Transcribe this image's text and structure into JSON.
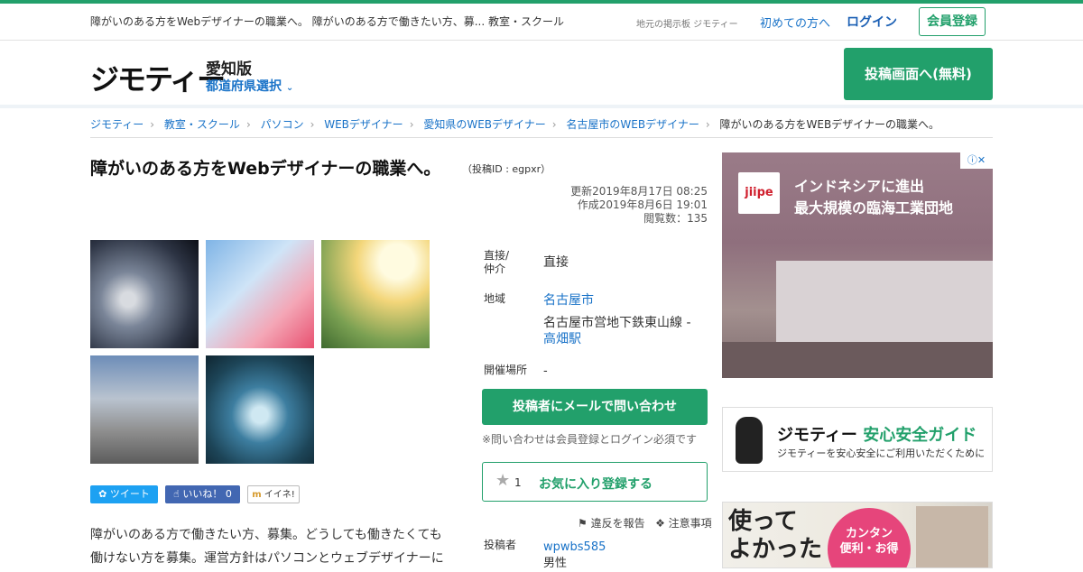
{
  "topbar": {
    "tagline": "障がいのある方をWebデザイナーの職業へ。 障がいのある方で働きたい方、募... 教室・スクール",
    "site_label": "地元の掲示板 ジモティー",
    "first_time": "初めての方へ",
    "login": "ログイン",
    "register": "会員登録"
  },
  "header": {
    "logo": "ジモティー",
    "edition": "愛知版",
    "prefecture_select": "都道府県選択",
    "post_button": "投稿画面へ(無料)"
  },
  "breadcrumbs": [
    "ジモティー",
    "教室・スクール",
    "パソコン",
    "WEBデザイナー",
    "愛知県のWEBデザイナー",
    "名古屋市のWEBデザイナー",
    "障がいのある方をWEBデザイナーの職業へ。"
  ],
  "listing": {
    "title": "障がいのある方をWebデザイナーの職業へ。",
    "post_id": "（投稿ID : egpxr）",
    "updated": "更新2019年8月17日 08:25",
    "created": "作成2019年8月6日 19:01",
    "views": "閲覧数：135",
    "description": "障がいのある方で働きたい方、募集。どうしても働きたくても働けない方を募集。運営方針はパソコンとウェブデザイナーに"
  },
  "social": {
    "tweet": "ツイート",
    "like": "いいね！",
    "like_count": "0",
    "iine": "イイネ!"
  },
  "details": {
    "type_label": "直接/仲介",
    "type_value": "直接",
    "area_label": "地域",
    "area_city": "名古屋市",
    "area_line": "名古屋市営地下鉄東山線 -",
    "area_station": "高畑駅",
    "venue_label": "開催場所",
    "venue_value": "-",
    "poster_label": "投稿者",
    "poster_name": "wpwbs585",
    "poster_gender": "男性"
  },
  "actions": {
    "contact_button": "投稿者にメールで問い合わせ",
    "contact_note": "※問い合わせは会員登録とログイン必須です",
    "favorite_count": "1",
    "favorite_button": "お気に入り登録する",
    "report": "違反を報告",
    "notice": "注意事項"
  },
  "ads": {
    "ad1_brand": "jiipe",
    "ad1_line1": "インドネシアに進出",
    "ad1_line2": "最大規模の臨海工業団地",
    "ad1_choice": "ⓘ✕",
    "guide_title_brand": "ジモティー",
    "guide_title_rest": "安心安全ガイド",
    "guide_sub": "ジモティーを安心安全にご利用いただくために",
    "ad2_big1": "使って",
    "ad2_big2": "よかった",
    "ad2_circle1": "カンタン",
    "ad2_circle2": "便利・お得"
  },
  "colors": {
    "accent_green": "#22a06b",
    "link_blue": "#1a73c8"
  }
}
